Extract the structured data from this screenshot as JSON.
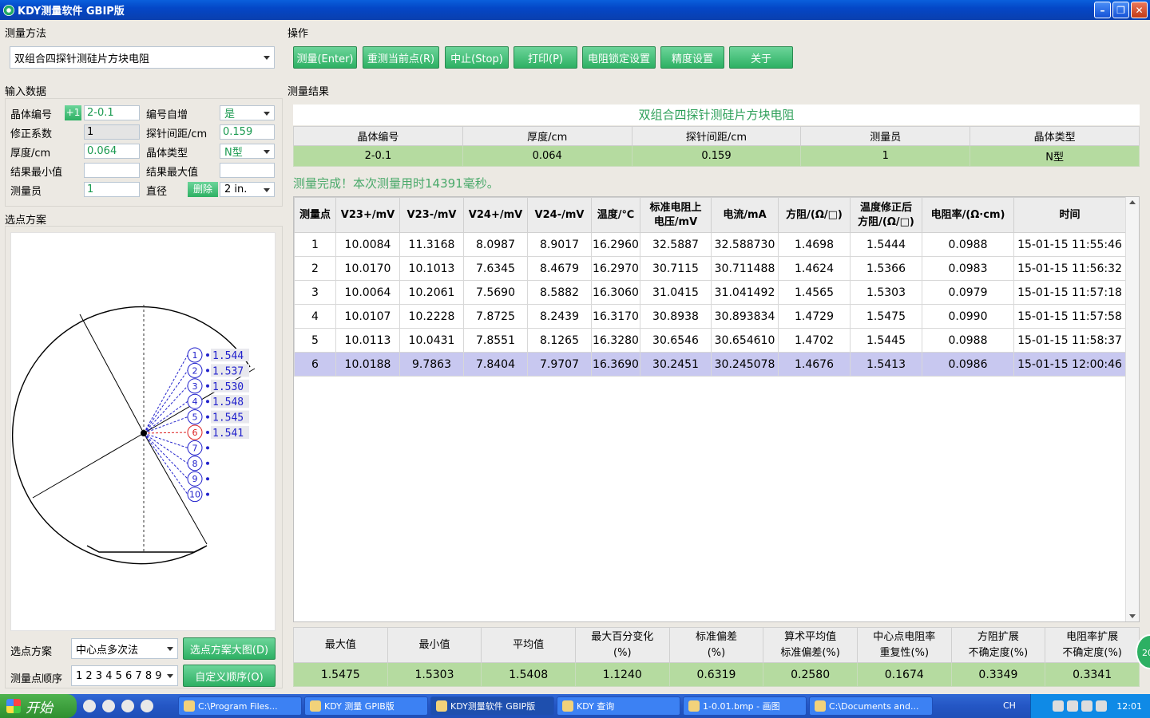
{
  "window": {
    "title": "KDY测量软件 GBIP版",
    "min": "–",
    "max": "❐",
    "close": "✕"
  },
  "sections": {
    "method": "测量方法",
    "ops": "操作",
    "input": "输入数据",
    "results": "测量结果",
    "scheme": "选点方案"
  },
  "method": {
    "selected": "双组合四探针测硅片方块电阻"
  },
  "ops": [
    "测量(Enter)",
    "重测当前点(R)",
    "中止(Stop)",
    "打印(P)",
    "电阻锁定设置",
    "精度设置",
    "关于"
  ],
  "input": {
    "crystal_no_label": "晶体编号",
    "plus_one": "+1",
    "crystal_no": "2-0.1",
    "auto_inc_label": "编号自增",
    "auto_inc": "是",
    "corr_label": "修正系数",
    "corr": "1",
    "probe_spacing_label": "探针间距/cm",
    "probe_spacing": "0.159",
    "thickness_label": "厚度/cm",
    "thickness": "0.064",
    "crystal_type_label": "晶体类型",
    "crystal_type": "N型",
    "min_label": "结果最小值",
    "min": "",
    "max_label": "结果最大值",
    "max": "",
    "operator_label": "测量员",
    "operator": "1",
    "diameter_label": "直径",
    "delete": "删除",
    "diameter": "2 in."
  },
  "scheme": {
    "plan_label": "选点方案",
    "plan": "中心点多次法",
    "big_btn": "选点方案大图(D)",
    "order_label": "测量点顺序",
    "order": "1 2 3 4 5 6 7 8 9",
    "custom_btn": "自定义顺序(O)",
    "points": [
      {
        "n": "1",
        "v": "1.544"
      },
      {
        "n": "2",
        "v": "1.537"
      },
      {
        "n": "3",
        "v": "1.530"
      },
      {
        "n": "4",
        "v": "1.548"
      },
      {
        "n": "5",
        "v": "1.545"
      },
      {
        "n": "6",
        "v": "1.541",
        "active": true
      },
      {
        "n": "7",
        "v": ""
      },
      {
        "n": "8",
        "v": ""
      },
      {
        "n": "9",
        "v": ""
      },
      {
        "n": "10",
        "v": ""
      }
    ]
  },
  "result": {
    "title": "双组合四探针测硅片方块电阻",
    "info_headers": [
      "晶体编号",
      "厚度/cm",
      "探针间距/cm",
      "测量员",
      "晶体类型"
    ],
    "info_values": [
      "2-0.1",
      "0.064",
      "0.159",
      "1",
      "N型"
    ],
    "status": "测量完成！本次测量用时14391毫秒。",
    "headers": [
      "测量点",
      "V23+/mV",
      "V23-/mV",
      "V24+/mV",
      "V24-/mV",
      "温度/℃",
      "标准电阻上\n电压/mV",
      "电流/mA",
      "方阻/(Ω/□)",
      "温度修正后\n方阻/(Ω/□)",
      "电阻率/(Ω·cm)",
      "时间"
    ],
    "rows": [
      [
        "1",
        "10.0084",
        "11.3168",
        "8.0987",
        "8.9017",
        "16.2960",
        "32.5887",
        "32.588730",
        "1.4698",
        "1.5444",
        "0.0988",
        "15-01-15 11:55:46"
      ],
      [
        "2",
        "10.0170",
        "10.1013",
        "7.6345",
        "8.4679",
        "16.2970",
        "30.7115",
        "30.711488",
        "1.4624",
        "1.5366",
        "0.0983",
        "15-01-15 11:56:32"
      ],
      [
        "3",
        "10.0064",
        "10.2061",
        "7.5690",
        "8.5882",
        "16.3060",
        "31.0415",
        "31.041492",
        "1.4565",
        "1.5303",
        "0.0979",
        "15-01-15 11:57:18"
      ],
      [
        "4",
        "10.0107",
        "10.2228",
        "7.8725",
        "8.2439",
        "16.3170",
        "30.8938",
        "30.893834",
        "1.4729",
        "1.5475",
        "0.0990",
        "15-01-15 11:57:58"
      ],
      [
        "5",
        "10.0113",
        "10.0431",
        "7.8551",
        "8.1265",
        "16.3280",
        "30.6546",
        "30.654610",
        "1.4702",
        "1.5445",
        "0.0988",
        "15-01-15 11:58:37"
      ],
      [
        "6",
        "10.0188",
        "9.7863",
        "7.8404",
        "7.9707",
        "16.3690",
        "30.2451",
        "30.245078",
        "1.4676",
        "1.5413",
        "0.0986",
        "15-01-15 12:00:46"
      ]
    ],
    "selected_row": 5,
    "stats_headers": [
      "最大值",
      "最小值",
      "平均值",
      "最大百分变化\n(%)",
      "标准偏差\n(%)",
      "算术平均值\n标准偏差(%)",
      "中心点电阻率\n重复性(%)",
      "方阻扩展\n不确定度(%)",
      "电阻率扩展\n不确定度(%)"
    ],
    "stats_values": [
      "1.5475",
      "1.5303",
      "1.5408",
      "1.1240",
      "0.6319",
      "0.2580",
      "0.1674",
      "0.3349",
      "0.3341"
    ],
    "badge": "20"
  },
  "taskbar": {
    "start": "开始",
    "tasks": [
      "C:\\Program Files...",
      "KDY 测量 GPIB版",
      "KDY测量软件 GBIP版",
      "KDY 查询",
      "1-0.01.bmp - 画图",
      "C:\\Documents and..."
    ],
    "lang": "CH",
    "clock": "12:01"
  },
  "colors": {
    "accent_green": "#2db063",
    "row_green": "#b5dba0",
    "selected_row": "#c8c8f0",
    "point_blue": "#2222cc",
    "point_red": "#dd2222"
  }
}
